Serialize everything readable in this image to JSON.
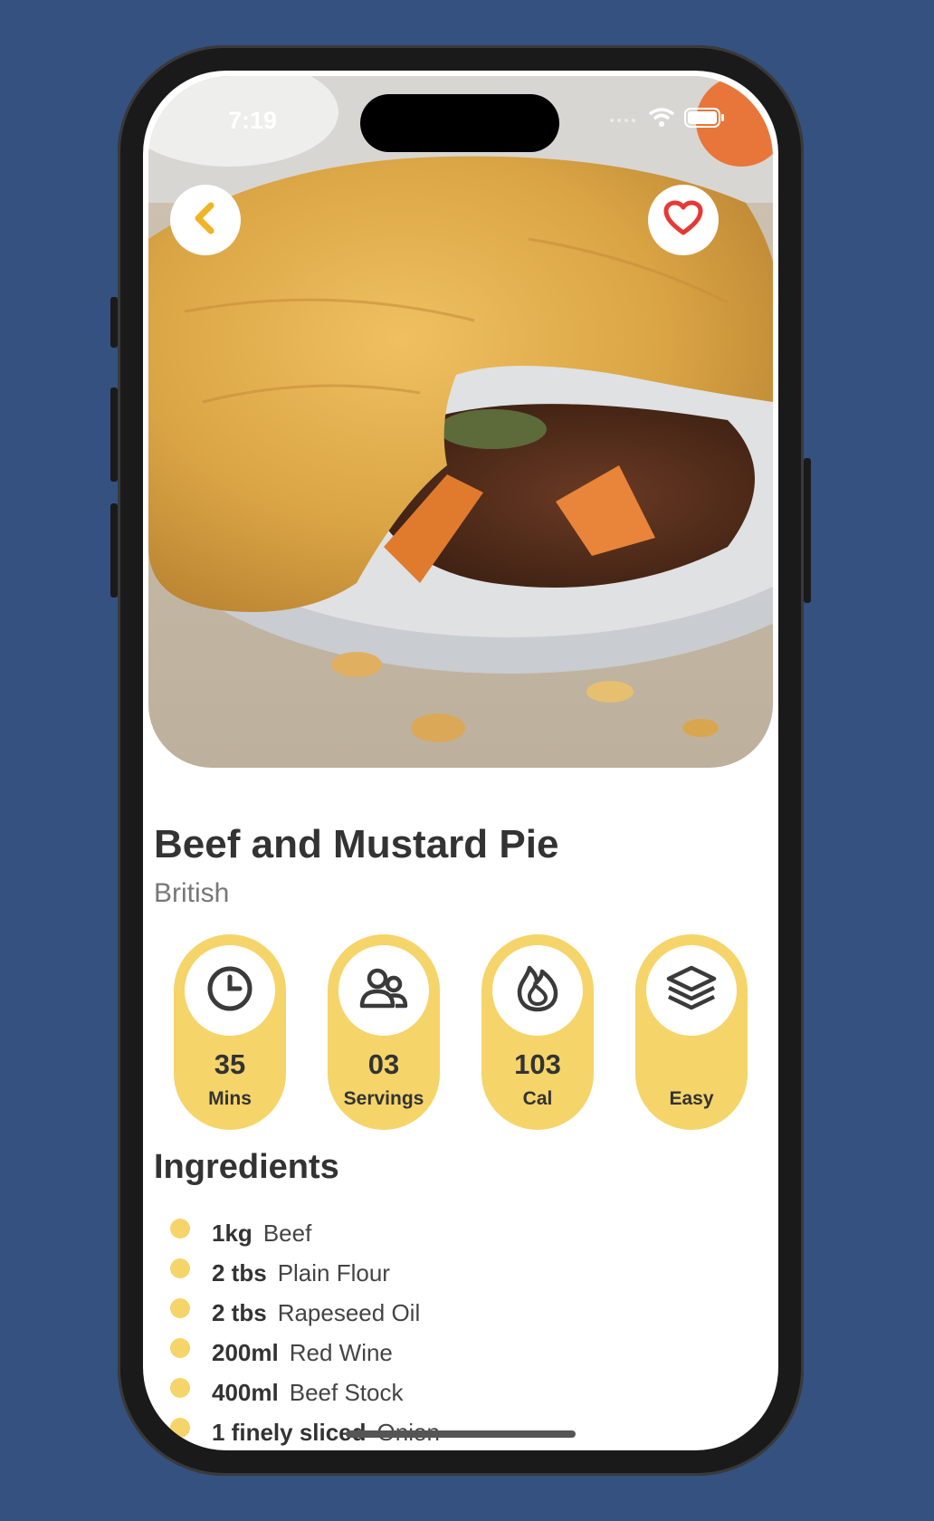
{
  "status_bar": {
    "time": "7:19"
  },
  "recipe": {
    "title": "Beef and Mustard Pie",
    "cuisine": "British"
  },
  "stats": [
    {
      "icon": "clock-icon",
      "value": "35",
      "label": "Mins"
    },
    {
      "icon": "users-icon",
      "value": "03",
      "label": "Servings"
    },
    {
      "icon": "flame-icon",
      "value": "103",
      "label": "Cal"
    },
    {
      "icon": "layers-icon",
      "value": "",
      "label": "Easy"
    }
  ],
  "ingredients": {
    "heading": "Ingredients",
    "items": [
      {
        "amount": "1kg",
        "name": "Beef"
      },
      {
        "amount": "2 tbs",
        "name": "Plain Flour"
      },
      {
        "amount": "2 tbs",
        "name": "Rapeseed Oil"
      },
      {
        "amount": "200ml",
        "name": "Red Wine"
      },
      {
        "amount": "400ml",
        "name": "Beef Stock"
      },
      {
        "amount": "1 finely sliced",
        "name": "Onion"
      }
    ]
  },
  "colors": {
    "accent": "#f5d46a",
    "heart": "#e53935",
    "back_arrow": "#f0b429",
    "background": "#34517f"
  }
}
